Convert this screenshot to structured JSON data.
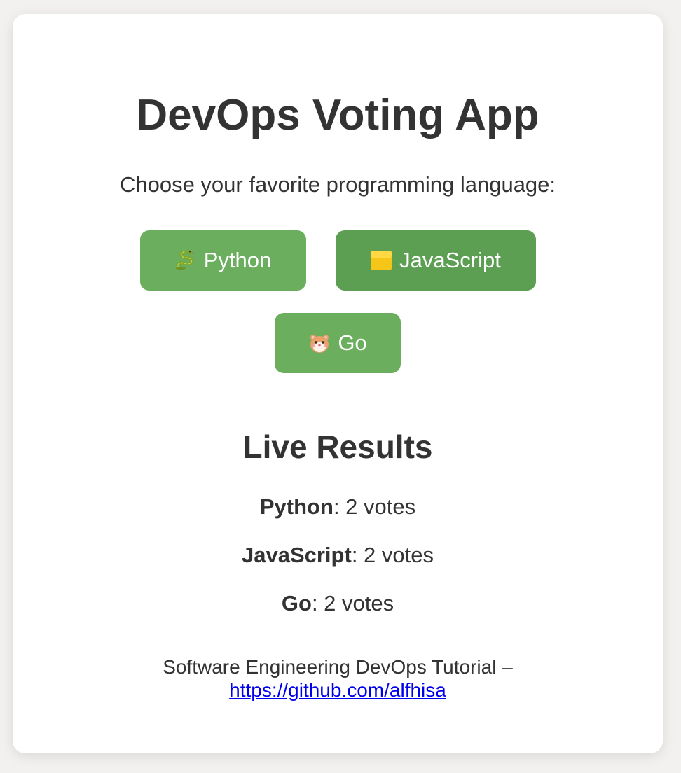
{
  "app": {
    "title": "DevOps Voting App",
    "subtitle": "Choose your favorite programming language:"
  },
  "buttons": [
    {
      "label": "Python",
      "icon": "snake-icon"
    },
    {
      "label": "JavaScript",
      "icon": "yellow-square-icon"
    },
    {
      "label": "Go",
      "icon": "gopher-icon"
    }
  ],
  "results": {
    "title": "Live Results",
    "items": [
      {
        "name": "Python",
        "suffix": ": 2 votes",
        "votes": 2
      },
      {
        "name": "JavaScript",
        "suffix": ": 2 votes",
        "votes": 2
      },
      {
        "name": "Go",
        "suffix": ": 2 votes",
        "votes": 2
      }
    ]
  },
  "footer": {
    "text": "Software Engineering DevOps Tutorial –",
    "link": "https://github.com/alfhisa"
  },
  "colors": {
    "button": "#6aae5e",
    "button_hover": "#5c9e52",
    "link": "#0000ee",
    "text": "#333333"
  }
}
